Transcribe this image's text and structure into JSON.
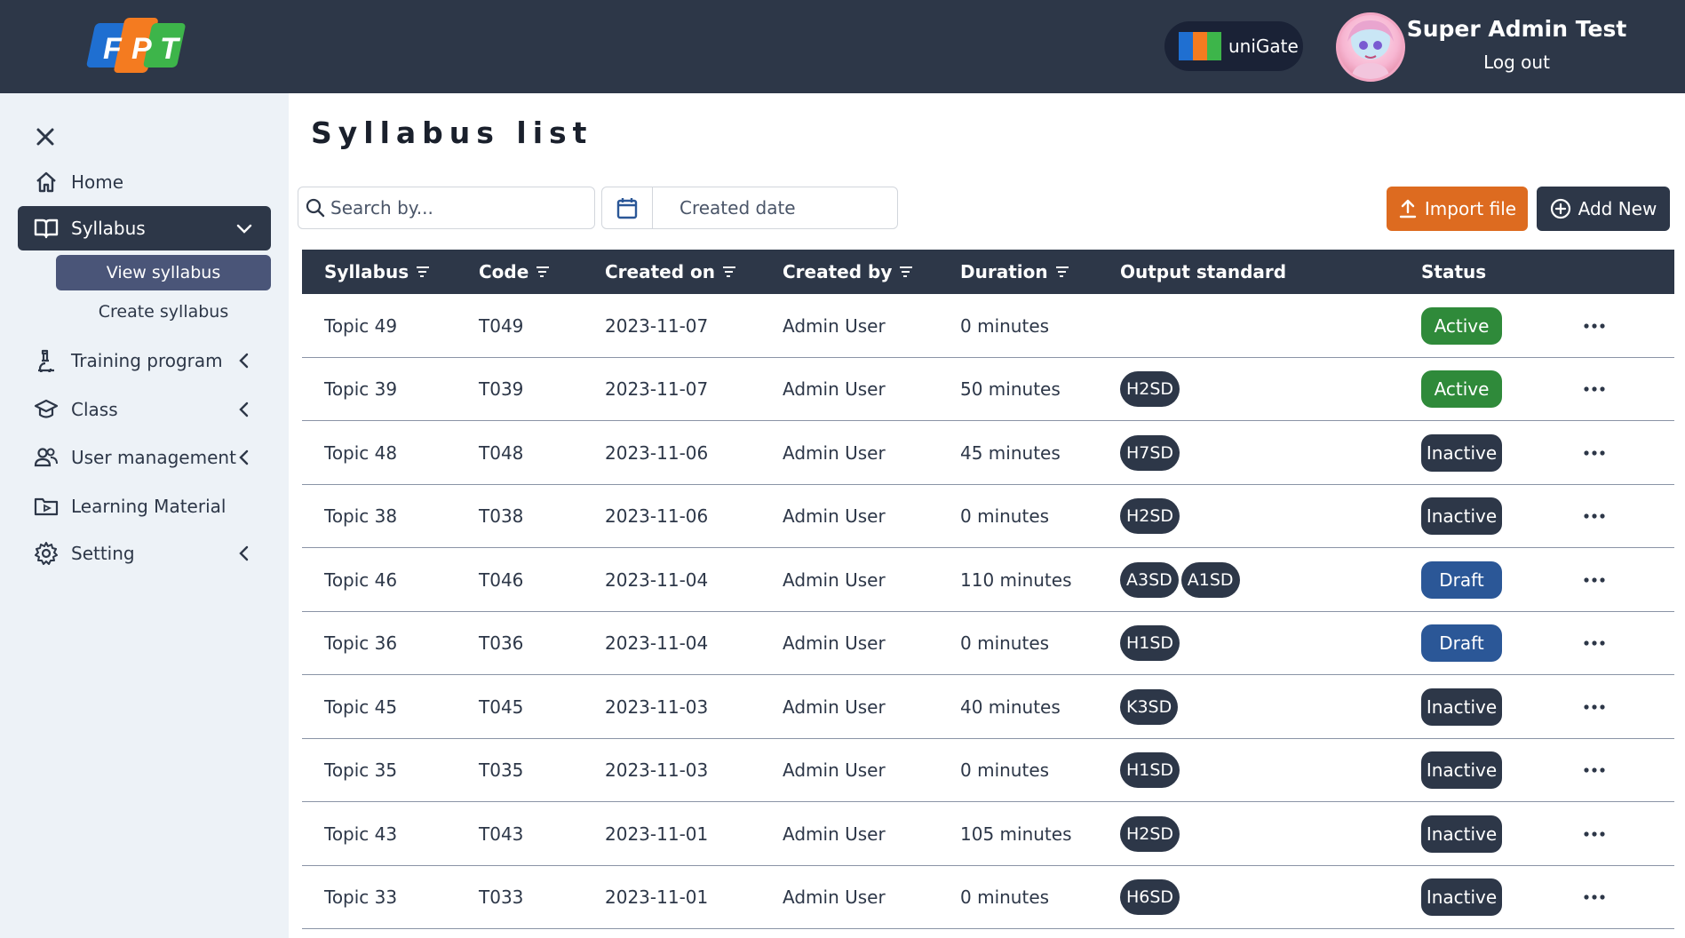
{
  "header": {
    "logo_letters": [
      "F",
      "P",
      "T"
    ],
    "logo_colors": [
      "#1f6fd1",
      "#f47b20",
      "#3db54a"
    ],
    "unigate_label": "uniGate",
    "user_name": "Super Admin Test",
    "logout_label": "Log out"
  },
  "sidebar": {
    "items": [
      {
        "label": "Home",
        "icon": "home-icon"
      },
      {
        "label": "Syllabus",
        "icon": "book-open-icon",
        "active": true,
        "expanded": true
      },
      {
        "label": "Training program",
        "icon": "microscope-icon"
      },
      {
        "label": "Class",
        "icon": "graduation-cap-icon"
      },
      {
        "label": "User management",
        "icon": "users-icon"
      },
      {
        "label": "Learning Material",
        "icon": "folder-video-icon"
      },
      {
        "label": "Setting",
        "icon": "gear-icon"
      }
    ],
    "sub_items": [
      {
        "label": "View syllabus",
        "active": true
      },
      {
        "label": "Create syllabus"
      }
    ]
  },
  "main": {
    "title": "Syllabus list",
    "search_placeholder": "Search by...",
    "date_label": "Created date",
    "import_label": "Import file",
    "add_label": "Add New"
  },
  "table": {
    "columns": [
      "Syllabus",
      "Code",
      "Created on",
      "Created by",
      "Duration",
      "Output standard",
      "Status"
    ],
    "rows": [
      {
        "syllabus": "Topic 49",
        "code": "T049",
        "created_on": "2023-11-07",
        "created_by": "Admin User",
        "duration": "0 minutes",
        "output": [],
        "status": "Active"
      },
      {
        "syllabus": "Topic 39",
        "code": "T039",
        "created_on": "2023-11-07",
        "created_by": "Admin User",
        "duration": "50 minutes",
        "output": [
          "H2SD"
        ],
        "status": "Active"
      },
      {
        "syllabus": "Topic 48",
        "code": "T048",
        "created_on": "2023-11-06",
        "created_by": "Admin User",
        "duration": "45 minutes",
        "output": [
          "H7SD"
        ],
        "status": "Inactive"
      },
      {
        "syllabus": "Topic 38",
        "code": "T038",
        "created_on": "2023-11-06",
        "created_by": "Admin User",
        "duration": "0 minutes",
        "output": [
          "H2SD"
        ],
        "status": "Inactive"
      },
      {
        "syllabus": "Topic 46",
        "code": "T046",
        "created_on": "2023-11-04",
        "created_by": "Admin User",
        "duration": "110 minutes",
        "output": [
          "A3SD",
          "A1SD"
        ],
        "status": "Draft"
      },
      {
        "syllabus": "Topic 36",
        "code": "T036",
        "created_on": "2023-11-04",
        "created_by": "Admin User",
        "duration": "0 minutes",
        "output": [
          "H1SD"
        ],
        "status": "Draft"
      },
      {
        "syllabus": "Topic 45",
        "code": "T045",
        "created_on": "2023-11-03",
        "created_by": "Admin User",
        "duration": "40 minutes",
        "output": [
          "K3SD"
        ],
        "status": "Inactive"
      },
      {
        "syllabus": "Topic 35",
        "code": "T035",
        "created_on": "2023-11-03",
        "created_by": "Admin User",
        "duration": "0 minutes",
        "output": [
          "H1SD"
        ],
        "status": "Inactive"
      },
      {
        "syllabus": "Topic 43",
        "code": "T043",
        "created_on": "2023-11-01",
        "created_by": "Admin User",
        "duration": "105 minutes",
        "output": [
          "H2SD"
        ],
        "status": "Inactive"
      },
      {
        "syllabus": "Topic 33",
        "code": "T033",
        "created_on": "2023-11-01",
        "created_by": "Admin User",
        "duration": "0 minutes",
        "output": [
          "H6SD"
        ],
        "status": "Inactive"
      }
    ]
  },
  "status_colors": {
    "Active": "#2f8a3a",
    "Inactive": "#2d3748",
    "Draft": "#2b5797"
  },
  "colors": {
    "header_bg": "#2d3748",
    "sidebar_bg": "#edf2f7",
    "import_btn": "#dd6b20",
    "add_btn": "#2d3748"
  }
}
